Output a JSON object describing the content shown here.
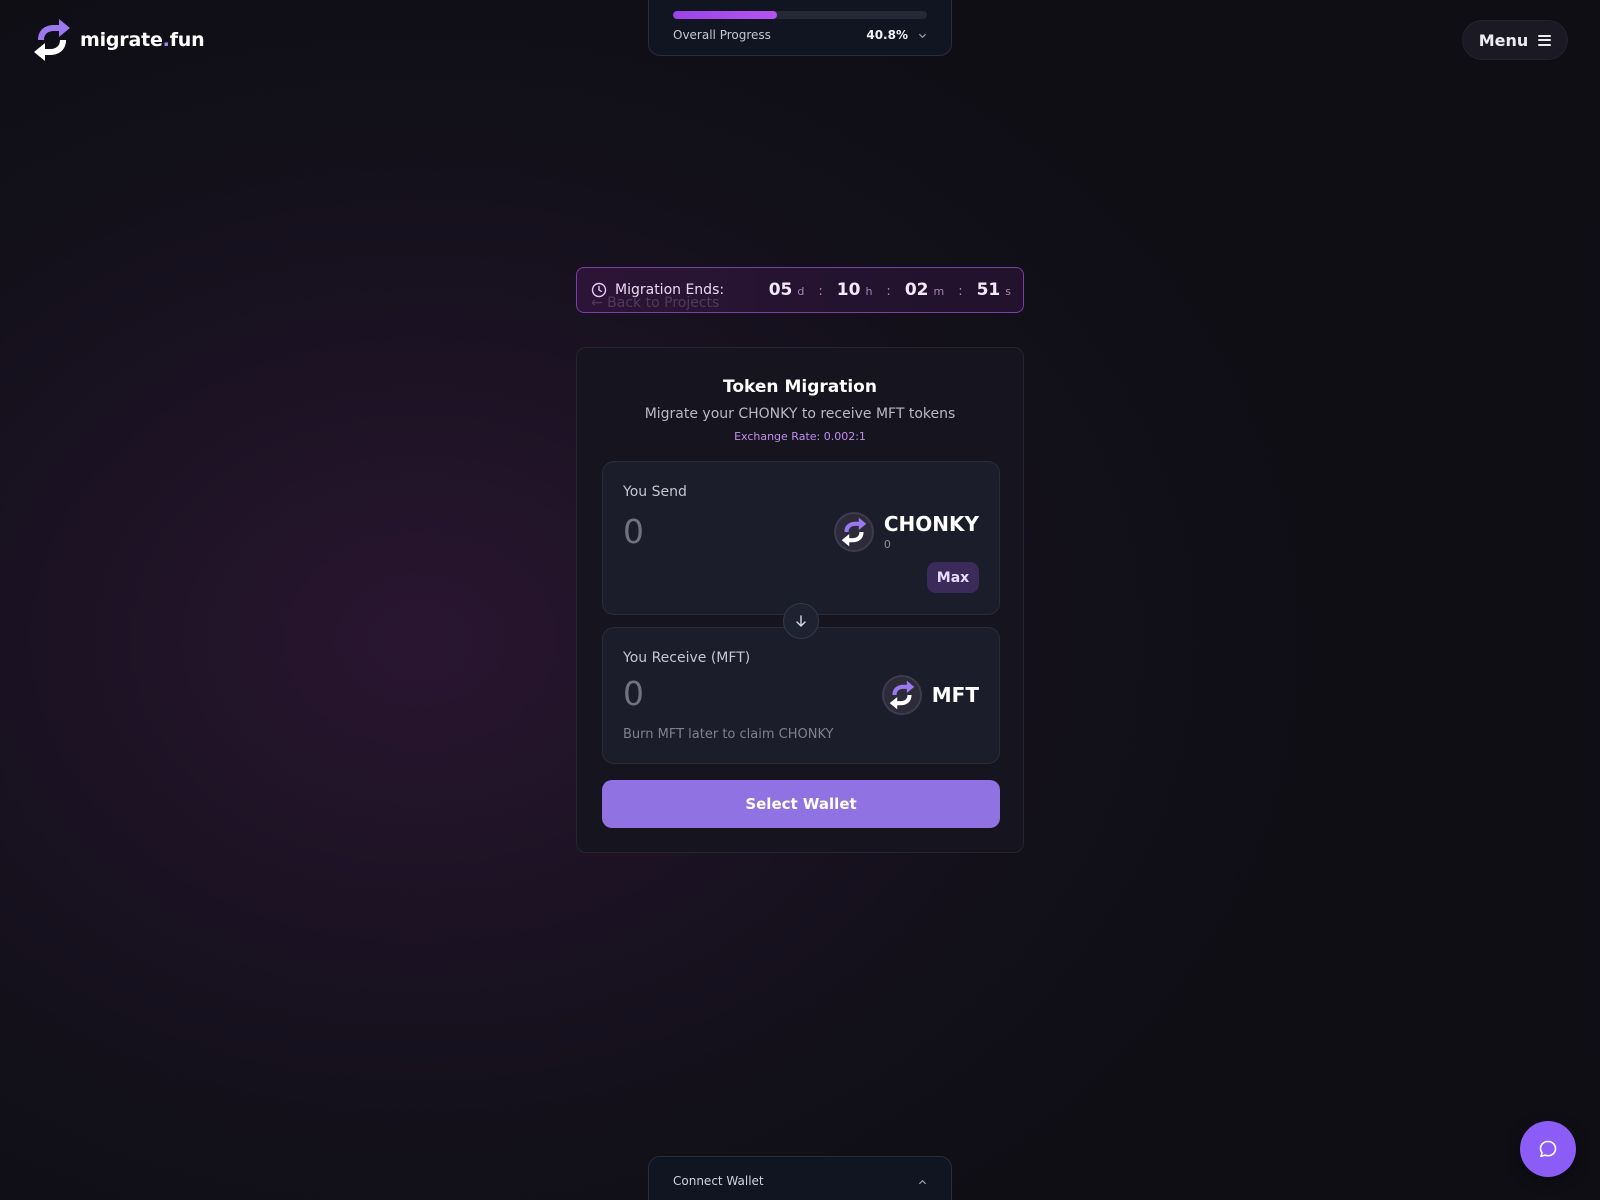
{
  "brand": {
    "name_main": "migrate",
    "name_dot": ".",
    "name_tld": "fun"
  },
  "header": {
    "menu_label": "Menu"
  },
  "progress": {
    "label": "Overall Progress",
    "value_text": "40.8%",
    "fraction": 0.408
  },
  "countdown": {
    "label": "Migration Ends:",
    "ghost_text": "← Back to Projects",
    "days": "05",
    "days_unit": "d",
    "hours": "10",
    "hours_unit": "h",
    "minutes": "02",
    "minutes_unit": "m",
    "seconds": "51",
    "seconds_unit": "s",
    "separator": ":"
  },
  "migration": {
    "title": "Token Migration",
    "subtitle": "Migrate your CHONKY to receive MFT tokens",
    "rate": "Exchange Rate: 0.002:1",
    "send": {
      "label": "You Send",
      "amount": "0",
      "token": "CHONKY",
      "balance": "0",
      "max_label": "Max"
    },
    "receive": {
      "label": "You Receive (MFT)",
      "amount": "0",
      "token": "MFT",
      "note": "Burn MFT later to claim CHONKY"
    },
    "cta": "Select Wallet"
  },
  "wallet_panel": {
    "label": "Connect Wallet"
  },
  "colors": {
    "accent": "#9072e2",
    "progress": "#a24bec",
    "chat": "#8b5cf6"
  },
  "icons": [
    "logo-icon",
    "menu-icon",
    "chevron-down-icon",
    "clock-icon",
    "token-icon",
    "arrow-down-icon",
    "chevron-up-icon",
    "chat-icon"
  ]
}
